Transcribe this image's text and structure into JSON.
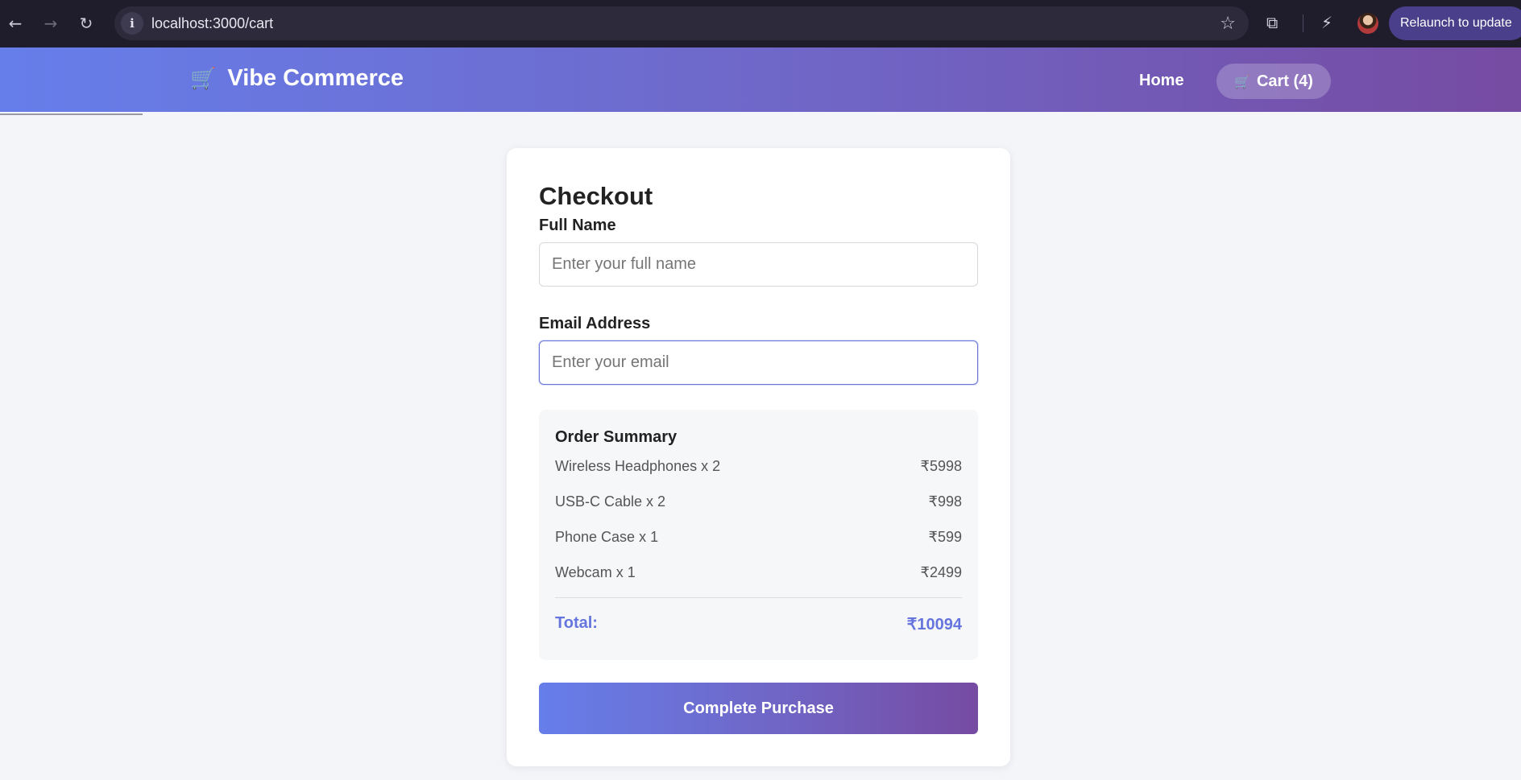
{
  "browser": {
    "back_icon": "←",
    "forward_icon": "→",
    "reload_icon": "↻",
    "info_icon": "i",
    "url": "localhost:3000/cart",
    "star_icon": "☆",
    "extensions_icon": "⧉",
    "performance_icon": "⚡",
    "relaunch_label": "Relaunch to update",
    "menu_icon": "⋮"
  },
  "header": {
    "brand_icon": "🛒",
    "brand_name": "Vibe Commerce",
    "nav_home": "Home",
    "cart_icon": "🛒",
    "nav_cart": "Cart (4)",
    "gradient_start": "#667eea",
    "gradient_end": "#764ba2"
  },
  "checkout": {
    "title": "Checkout",
    "full_name_label": "Full Name",
    "full_name_placeholder": "Enter your full name",
    "full_name_value": "",
    "email_label": "Email Address",
    "email_placeholder": "Enter your email",
    "email_value": "",
    "summary": {
      "title": "Order Summary",
      "items": [
        {
          "name": "Wireless Headphones x 2",
          "price": "₹5998"
        },
        {
          "name": "USB-C Cable x 2",
          "price": "₹998"
        },
        {
          "name": "Phone Case x 1",
          "price": "₹599"
        },
        {
          "name": "Webcam x 1",
          "price": "₹2499"
        }
      ],
      "total_label": "Total:",
      "total_value": "₹10094"
    },
    "purchase_button": "Complete Purchase",
    "accent_color": "#667eea"
  }
}
